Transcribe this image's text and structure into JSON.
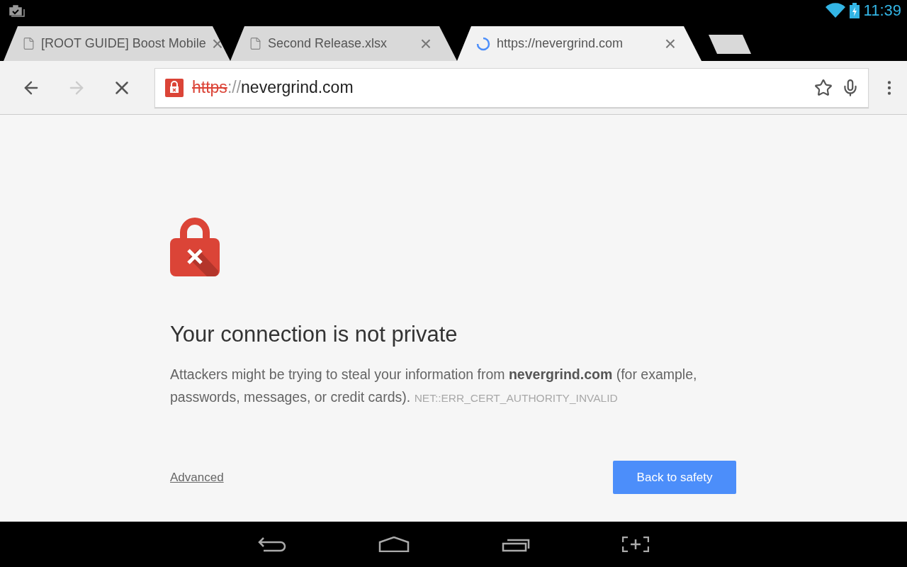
{
  "status_bar": {
    "time": "11:39"
  },
  "tabs": [
    {
      "kind": "page",
      "title": "[ROOT GUIDE] Boost Mobile",
      "close": "×",
      "selected": false
    },
    {
      "kind": "page",
      "title": "Second Release.xlsx",
      "close": "×",
      "selected": false
    },
    {
      "kind": "loading",
      "title": "https://nevergrind.com",
      "close": "×",
      "selected": true
    }
  ],
  "toolbar": {
    "forward_disabled": true,
    "address": {
      "scheme": "https",
      "separator": "://",
      "host": "nevergrind.com",
      "secure": false
    }
  },
  "interstitial": {
    "heading": "Your connection is not private",
    "body": "Attackers might be trying to steal your information from **nevergrind.com** (for example, passwords, messages, or credit cards).",
    "error_code": "NET::ERR_CERT_AUTHORITY_INVALID",
    "advanced_link": "Advanced",
    "primary_button": "Back to safety"
  }
}
